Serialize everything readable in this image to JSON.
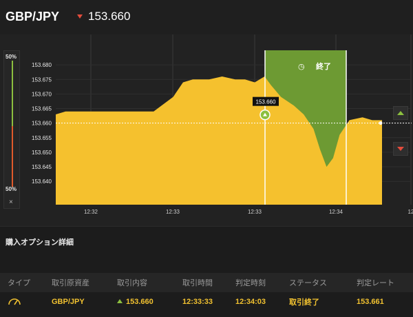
{
  "header": {
    "pair": "GBP/JPY",
    "rate": "153.660",
    "rate_direction_icon": "down-triangle-icon",
    "colors": {
      "down": "#e34c3c",
      "up": "#8cbf3f"
    }
  },
  "gauge": {
    "top_label": "50%",
    "bottom_label": "50%",
    "close_label": "×",
    "up_share_percent": 50,
    "down_share_percent": 50
  },
  "chart_data": {
    "type": "area",
    "y_ticks": [
      "153.680",
      "153.675",
      "153.670",
      "153.665",
      "153.660",
      "153.655",
      "153.650",
      "153.645",
      "153.640"
    ],
    "x_ticks": [
      "12:32",
      "12:33",
      "12:33",
      "12:34",
      "12"
    ],
    "ylim": [
      153.632,
      153.685
    ],
    "current_rate": 153.66,
    "entry_marker_label": "153.660",
    "option_window_label": "終了",
    "fill_color": "#f5c12e",
    "window_color": "#6d9a33",
    "series_x": [
      0,
      3,
      7,
      14,
      22,
      30,
      36,
      39,
      42,
      47,
      51,
      55,
      58,
      61,
      64,
      66,
      69,
      73,
      76,
      79,
      81,
      83,
      85,
      87,
      90,
      94,
      97,
      100
    ],
    "series_y": [
      153.663,
      153.664,
      153.664,
      153.664,
      153.664,
      153.664,
      153.669,
      153.674,
      153.675,
      153.675,
      153.676,
      153.675,
      153.675,
      153.674,
      153.676,
      153.673,
      153.669,
      153.666,
      153.663,
      153.658,
      153.651,
      153.645,
      153.648,
      153.656,
      153.661,
      153.662,
      153.661,
      153.661
    ]
  },
  "side_buttons": {
    "up_icon": "up-arrow-icon",
    "down_icon": "down-arrow-icon"
  },
  "section": {
    "title": "購入オプション詳細"
  },
  "table": {
    "headers": [
      "タイプ",
      "取引原資産",
      "取引内容",
      "取引時間",
      "判定時刻",
      "ステータス",
      "判定レート"
    ],
    "row": {
      "type_icon": "gauge-icon",
      "asset": "GBP/JPY",
      "direction_icon": "up-triangle-icon",
      "content": "153.660",
      "trade_time": "12:33:33",
      "judge_time": "12:34:03",
      "status": "取引終了",
      "judge_rate": "153.661"
    }
  }
}
